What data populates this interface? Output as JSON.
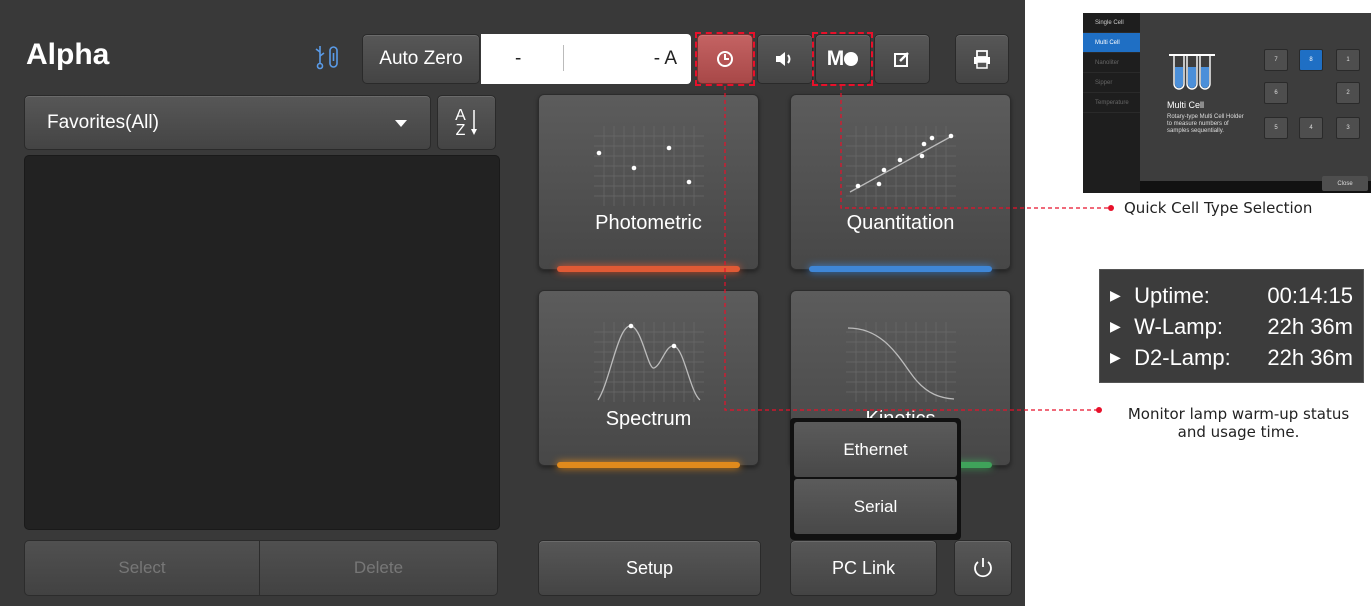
{
  "header": {
    "app_title": "Alpha",
    "usb_icon": "usb-link-icon",
    "auto_zero_label": "Auto Zero",
    "readout_left": "-",
    "readout_right": "- A",
    "history_icon": "clock-icon",
    "sound_icon": "speaker-icon",
    "multi_cell_label": "M",
    "edit_icon": "edit-icon",
    "print_icon": "printer-icon",
    "highlight_color": "#e8102a"
  },
  "favorites": {
    "dropdown_label": "Favorites(All)",
    "sort_label_a": "A",
    "sort_label_z": "Z",
    "select_label": "Select",
    "delete_label": "Delete"
  },
  "tiles": [
    {
      "label": "Photometric",
      "accent": "#e05a35"
    },
    {
      "label": "Quantitation",
      "accent": "#3f86d6"
    },
    {
      "label": "Spectrum",
      "accent": "#e08a1c"
    },
    {
      "label": "Kinetics",
      "accent": "#3fa35a"
    }
  ],
  "bottom": {
    "setup_label": "Setup",
    "pc_link_label": "PC Link",
    "power_icon": "power-icon"
  },
  "pc_link_menu": {
    "items": [
      "Ethernet",
      "Serial"
    ]
  },
  "cell_dialog": {
    "sidebar": [
      "Single Cell",
      "Multi Cell",
      "Nanoliter",
      "Sipper",
      "Temperature"
    ],
    "selected": "Multi Cell",
    "name": "Multi Cell",
    "description": "Rotary-type Multi Cell Holder to measure numbers of samples sequentially.",
    "positions": [
      "7",
      "8",
      "1",
      "6",
      "2",
      "5",
      "4",
      "3"
    ],
    "selected_position": "8",
    "close_label": "Close"
  },
  "callouts": {
    "cell_type": "Quick Cell Type Selection",
    "lamp_line1": "Monitor lamp warm-up status",
    "lamp_line2": "and usage time."
  },
  "lamp_status": {
    "rows": [
      {
        "label": "Uptime:",
        "value": "00:14:15"
      },
      {
        "label": "W-Lamp:",
        "value": "22h 36m"
      },
      {
        "label": "D2-Lamp:",
        "value": "22h 36m"
      }
    ]
  }
}
